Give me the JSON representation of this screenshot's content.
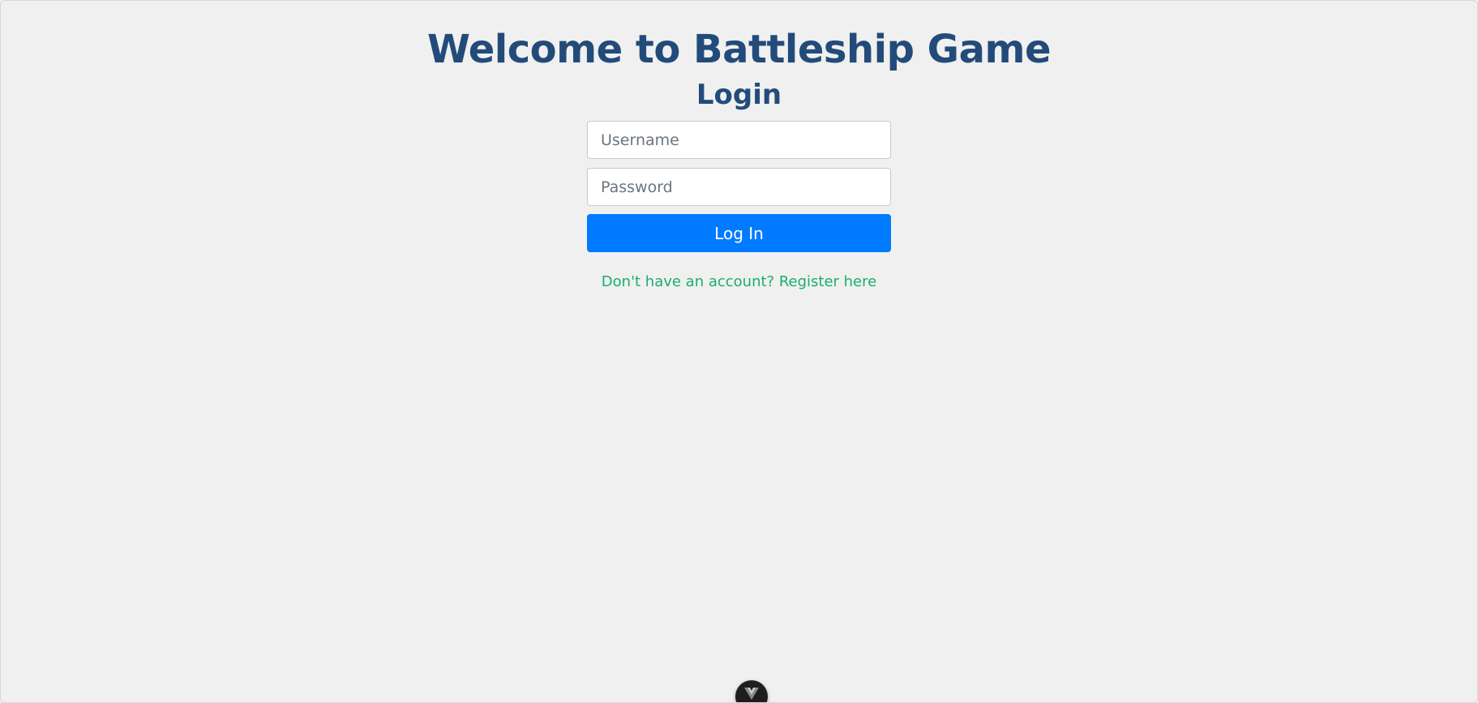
{
  "header": {
    "title": "Welcome to Battleship Game",
    "subtitle": "Login"
  },
  "form": {
    "username": {
      "placeholder": "Username",
      "value": ""
    },
    "password": {
      "placeholder": "Password",
      "value": ""
    },
    "submit_label": "Log In",
    "register_link": "Don't have an account? Register here"
  },
  "icons": {
    "devtools_toggle": "vue-logo-icon"
  },
  "colors": {
    "background": "#f0f0f0",
    "heading": "#234b7a",
    "primary_button": "#007bff",
    "link": "#1aae6f",
    "devtools_toggle_bg": "#1e1e1e"
  }
}
